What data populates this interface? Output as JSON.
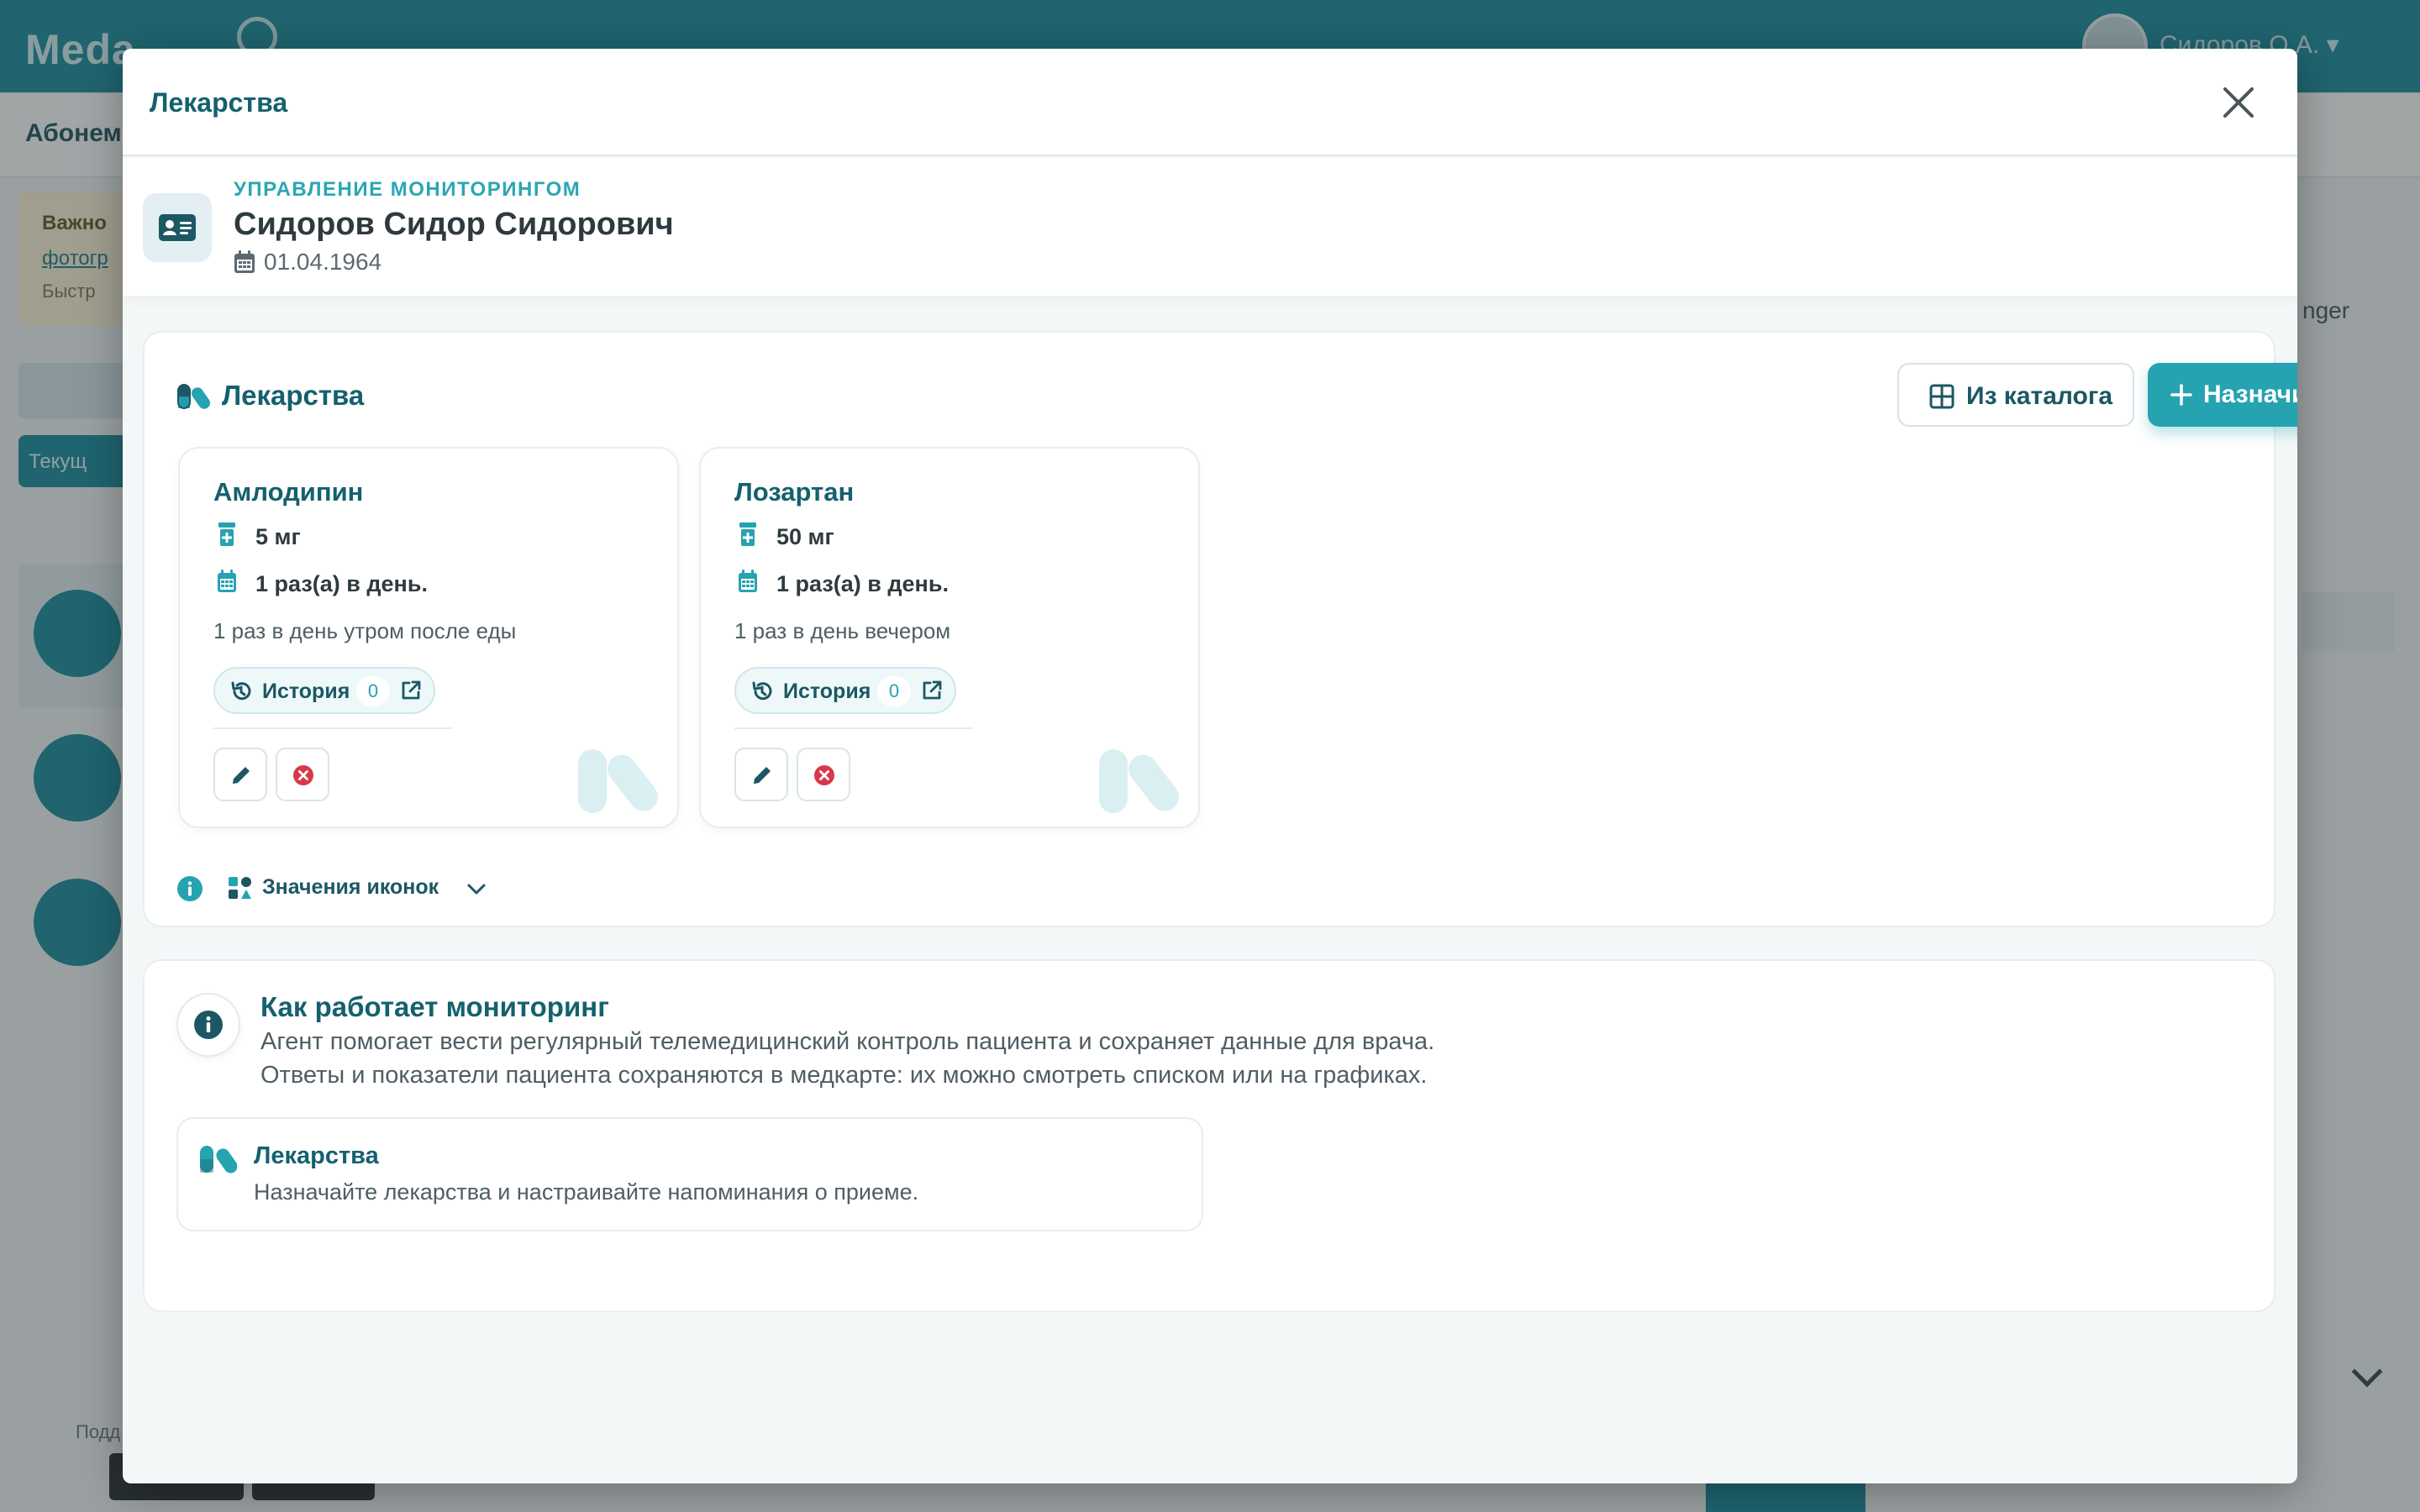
{
  "background_app": {
    "logo": "Meda",
    "user_name": "Сидоров О.А. ▾",
    "tab_label": "Абонем",
    "notice_title": "Важно",
    "notice_link": "фотогр",
    "notice_text": "Быстр",
    "current_button": "Текущ",
    "side_text": "nger",
    "footer_label": "Подд"
  },
  "modal": {
    "title": "Лекарства",
    "close_label": "close"
  },
  "patient": {
    "kicker": "УПРАВЛЕНИЕ МОНИТОРИНГОМ",
    "name": "Сидоров Сидор Сидорович",
    "birth_date": "01.04.1964"
  },
  "medications": {
    "title": "Лекарства",
    "catalog_button": "Из каталога",
    "assign_button": "Назначить",
    "items": [
      {
        "name": "Амлодипин",
        "dose": "5 мг",
        "frequency": "1 раз(а) в день.",
        "note": "1 раз в день утром после еды",
        "history_label": "История",
        "history_count": "0"
      },
      {
        "name": "Лозартан",
        "dose": "50 мг",
        "frequency": "1 раз(а) в день.",
        "note": "1 раз в день вечером",
        "history_label": "История",
        "history_count": "0"
      }
    ],
    "legend_toggle": "Значения иконок"
  },
  "how_it_works": {
    "title": "Как работает мониторинг",
    "line1": "Агент помогает вести регулярный телемедицинский контроль пациента и сохраняет данные для врача.",
    "line2": "Ответы и показатели пациента сохраняются в медкарте: их можно смотреть списком или на графиках.",
    "feature": {
      "title": "Лекарства",
      "description": "Назначайте лекарства и настраивайте напоминания о приеме."
    }
  },
  "colors": {
    "primary_teal": "#25a3b1",
    "heading_teal": "#14616d",
    "danger_red": "#d63a4a"
  },
  "icons": {
    "patient": "id-card-icon",
    "calendar": "calendar-icon",
    "medications": "pills-icon",
    "catalog": "grid-icon",
    "assign": "plus-icon",
    "dose": "pill-bottle-icon",
    "history": "history-icon",
    "external": "external-link-icon",
    "edit": "pencil-icon",
    "cancel": "x-circle-icon",
    "info": "info-icon",
    "legend": "shapes-icon",
    "chevron": "chevron-down-icon",
    "close": "close-icon"
  }
}
